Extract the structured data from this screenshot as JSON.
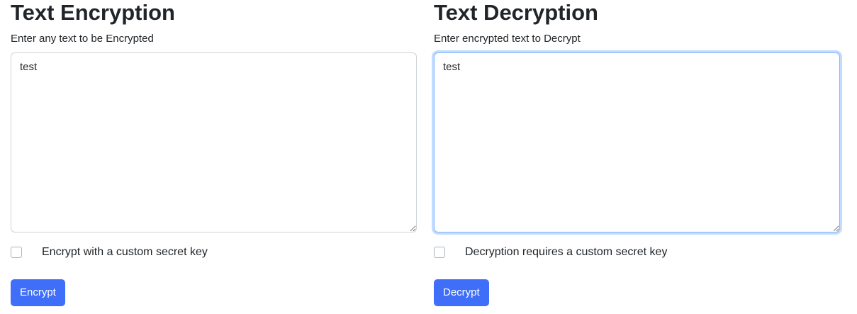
{
  "encryption": {
    "title": "Text Encryption",
    "input_label": "Enter any text to be Encrypted",
    "input_value": "test",
    "checkbox_label": "Encrypt with a custom secret key",
    "checkbox_checked": false,
    "button_label": "Encrypt"
  },
  "decryption": {
    "title": "Text Decryption",
    "input_label": "Enter encrypted text to Decrypt",
    "input_value": "test",
    "checkbox_label": "Decryption requires a custom secret key",
    "checkbox_checked": false,
    "button_label": "Decrypt"
  },
  "colors": {
    "button_primary": "#3f6ef8",
    "focus_ring": "#86b7fe",
    "text": "#212529",
    "border": "#ced4da"
  }
}
